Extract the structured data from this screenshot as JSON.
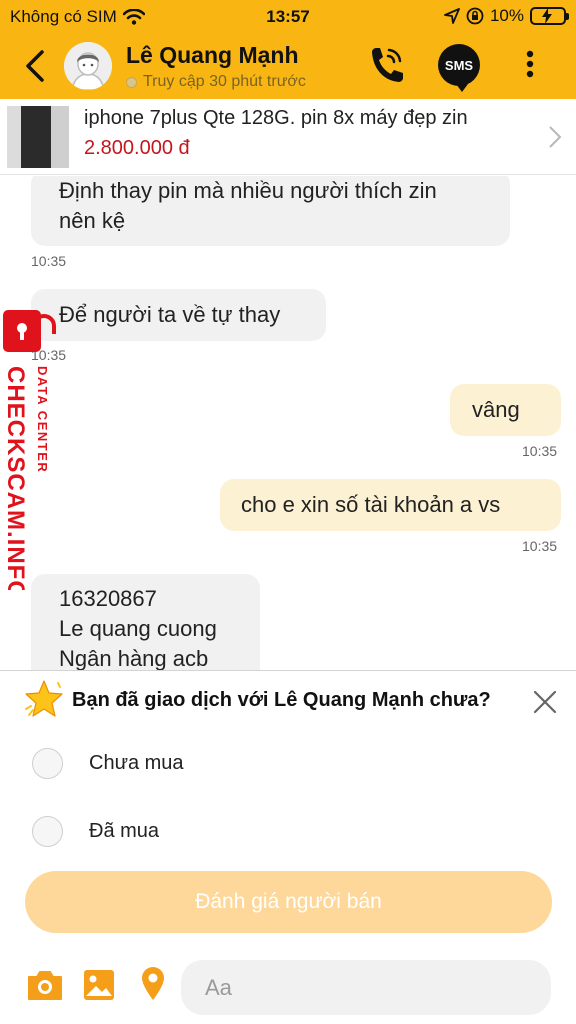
{
  "status_bar": {
    "carrier": "Không có SIM",
    "time": "13:57",
    "battery": "10%",
    "icons": [
      "wifi-icon",
      "location-arrow-icon",
      "orientation-lock-icon",
      "battery-charging-icon"
    ]
  },
  "header": {
    "contact_name": "Lê Quang Mạnh",
    "presence": "Truy cập 30 phút trước",
    "sms_label": "SMS",
    "accent_color": "#f9b613"
  },
  "product": {
    "title": "iphone 7plus Qte 128G. pin 8x máy đẹp zin",
    "price": "2.800.000 đ",
    "price_color": "#c4161c"
  },
  "messages": [
    {
      "side": "in",
      "lines": [
        "Định thay pin mà nhiều người thích zin",
        "nên kệ"
      ],
      "time": "10:35"
    },
    {
      "side": "in",
      "lines": [
        "Để người ta về tự thay"
      ],
      "time": "10:35"
    },
    {
      "side": "out",
      "lines": [
        "vâng"
      ],
      "time": "10:35"
    },
    {
      "side": "out",
      "lines": [
        "cho e xin số tài khoản a vs"
      ],
      "time": "10:35"
    },
    {
      "side": "in",
      "lines": [
        "16320867",
        "Le quang cuong",
        "Ngân hàng acb"
      ],
      "time": ""
    }
  ],
  "watermark": {
    "brand": "CHECKSCAM.INFO",
    "subtitle": "DATA CENTER",
    "color": "#e0121b"
  },
  "survey": {
    "question": "Bạn đã giao dịch với Lê Quang Mạnh chưa?",
    "options": [
      "Chưa mua",
      "Đã mua"
    ],
    "rate_button": "Đánh giá người bán"
  },
  "input_bar": {
    "placeholder": "Aa",
    "icons": [
      "camera-icon",
      "image-icon",
      "location-pin-icon"
    ],
    "icon_color": "#f59e1a"
  }
}
